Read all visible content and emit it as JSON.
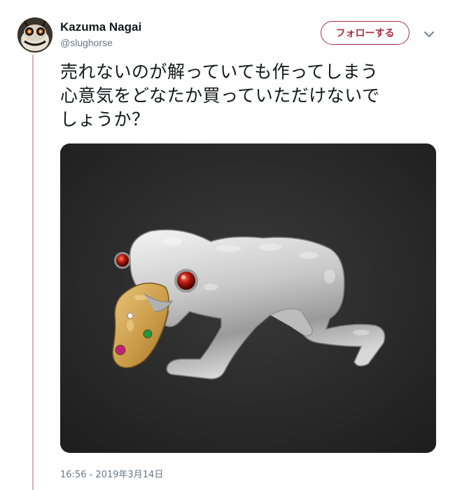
{
  "user": {
    "display_name": "Kazuma Nagai",
    "handle": "@slughorse",
    "avatar_icon": "creature-avatar-icon"
  },
  "follow_button": {
    "label": "フォローする"
  },
  "more_button": {
    "icon": "chevron-down-icon"
  },
  "tweet": {
    "text": "売れないのが解っていても作ってしまう\n心意気をどなたか買っていただけないで\nしょうか？",
    "timestamp": "16:56 - 2019年3月14日"
  },
  "photo": {
    "subject": "silver-creature-brooch",
    "icon": "brooch-photo"
  },
  "colors": {
    "accent": "#ab2d42",
    "thread_line": "#d9b3b9",
    "secondary_text": "#657786",
    "text": "#14171a"
  }
}
